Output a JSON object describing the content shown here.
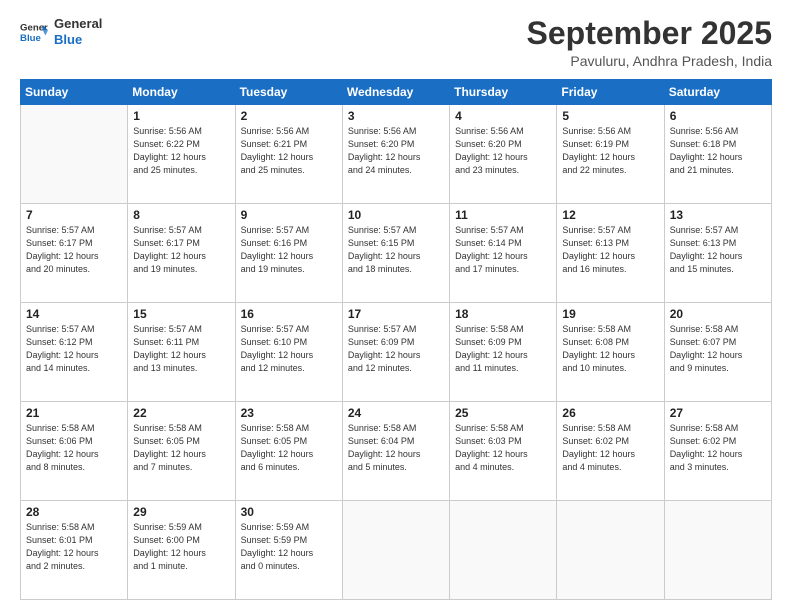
{
  "header": {
    "logo_line1": "General",
    "logo_line2": "Blue",
    "month_title": "September 2025",
    "location": "Pavuluru, Andhra Pradesh, India"
  },
  "weekdays": [
    "Sunday",
    "Monday",
    "Tuesday",
    "Wednesday",
    "Thursday",
    "Friday",
    "Saturday"
  ],
  "weeks": [
    [
      {
        "day": "",
        "info": ""
      },
      {
        "day": "1",
        "info": "Sunrise: 5:56 AM\nSunset: 6:22 PM\nDaylight: 12 hours\nand 25 minutes."
      },
      {
        "day": "2",
        "info": "Sunrise: 5:56 AM\nSunset: 6:21 PM\nDaylight: 12 hours\nand 25 minutes."
      },
      {
        "day": "3",
        "info": "Sunrise: 5:56 AM\nSunset: 6:20 PM\nDaylight: 12 hours\nand 24 minutes."
      },
      {
        "day": "4",
        "info": "Sunrise: 5:56 AM\nSunset: 6:20 PM\nDaylight: 12 hours\nand 23 minutes."
      },
      {
        "day": "5",
        "info": "Sunrise: 5:56 AM\nSunset: 6:19 PM\nDaylight: 12 hours\nand 22 minutes."
      },
      {
        "day": "6",
        "info": "Sunrise: 5:56 AM\nSunset: 6:18 PM\nDaylight: 12 hours\nand 21 minutes."
      }
    ],
    [
      {
        "day": "7",
        "info": "Sunrise: 5:57 AM\nSunset: 6:17 PM\nDaylight: 12 hours\nand 20 minutes."
      },
      {
        "day": "8",
        "info": "Sunrise: 5:57 AM\nSunset: 6:17 PM\nDaylight: 12 hours\nand 19 minutes."
      },
      {
        "day": "9",
        "info": "Sunrise: 5:57 AM\nSunset: 6:16 PM\nDaylight: 12 hours\nand 19 minutes."
      },
      {
        "day": "10",
        "info": "Sunrise: 5:57 AM\nSunset: 6:15 PM\nDaylight: 12 hours\nand 18 minutes."
      },
      {
        "day": "11",
        "info": "Sunrise: 5:57 AM\nSunset: 6:14 PM\nDaylight: 12 hours\nand 17 minutes."
      },
      {
        "day": "12",
        "info": "Sunrise: 5:57 AM\nSunset: 6:13 PM\nDaylight: 12 hours\nand 16 minutes."
      },
      {
        "day": "13",
        "info": "Sunrise: 5:57 AM\nSunset: 6:13 PM\nDaylight: 12 hours\nand 15 minutes."
      }
    ],
    [
      {
        "day": "14",
        "info": "Sunrise: 5:57 AM\nSunset: 6:12 PM\nDaylight: 12 hours\nand 14 minutes."
      },
      {
        "day": "15",
        "info": "Sunrise: 5:57 AM\nSunset: 6:11 PM\nDaylight: 12 hours\nand 13 minutes."
      },
      {
        "day": "16",
        "info": "Sunrise: 5:57 AM\nSunset: 6:10 PM\nDaylight: 12 hours\nand 12 minutes."
      },
      {
        "day": "17",
        "info": "Sunrise: 5:57 AM\nSunset: 6:09 PM\nDaylight: 12 hours\nand 12 minutes."
      },
      {
        "day": "18",
        "info": "Sunrise: 5:58 AM\nSunset: 6:09 PM\nDaylight: 12 hours\nand 11 minutes."
      },
      {
        "day": "19",
        "info": "Sunrise: 5:58 AM\nSunset: 6:08 PM\nDaylight: 12 hours\nand 10 minutes."
      },
      {
        "day": "20",
        "info": "Sunrise: 5:58 AM\nSunset: 6:07 PM\nDaylight: 12 hours\nand 9 minutes."
      }
    ],
    [
      {
        "day": "21",
        "info": "Sunrise: 5:58 AM\nSunset: 6:06 PM\nDaylight: 12 hours\nand 8 minutes."
      },
      {
        "day": "22",
        "info": "Sunrise: 5:58 AM\nSunset: 6:05 PM\nDaylight: 12 hours\nand 7 minutes."
      },
      {
        "day": "23",
        "info": "Sunrise: 5:58 AM\nSunset: 6:05 PM\nDaylight: 12 hours\nand 6 minutes."
      },
      {
        "day": "24",
        "info": "Sunrise: 5:58 AM\nSunset: 6:04 PM\nDaylight: 12 hours\nand 5 minutes."
      },
      {
        "day": "25",
        "info": "Sunrise: 5:58 AM\nSunset: 6:03 PM\nDaylight: 12 hours\nand 4 minutes."
      },
      {
        "day": "26",
        "info": "Sunrise: 5:58 AM\nSunset: 6:02 PM\nDaylight: 12 hours\nand 4 minutes."
      },
      {
        "day": "27",
        "info": "Sunrise: 5:58 AM\nSunset: 6:02 PM\nDaylight: 12 hours\nand 3 minutes."
      }
    ],
    [
      {
        "day": "28",
        "info": "Sunrise: 5:58 AM\nSunset: 6:01 PM\nDaylight: 12 hours\nand 2 minutes."
      },
      {
        "day": "29",
        "info": "Sunrise: 5:59 AM\nSunset: 6:00 PM\nDaylight: 12 hours\nand 1 minute."
      },
      {
        "day": "30",
        "info": "Sunrise: 5:59 AM\nSunset: 5:59 PM\nDaylight: 12 hours\nand 0 minutes."
      },
      {
        "day": "",
        "info": ""
      },
      {
        "day": "",
        "info": ""
      },
      {
        "day": "",
        "info": ""
      },
      {
        "day": "",
        "info": ""
      }
    ]
  ]
}
